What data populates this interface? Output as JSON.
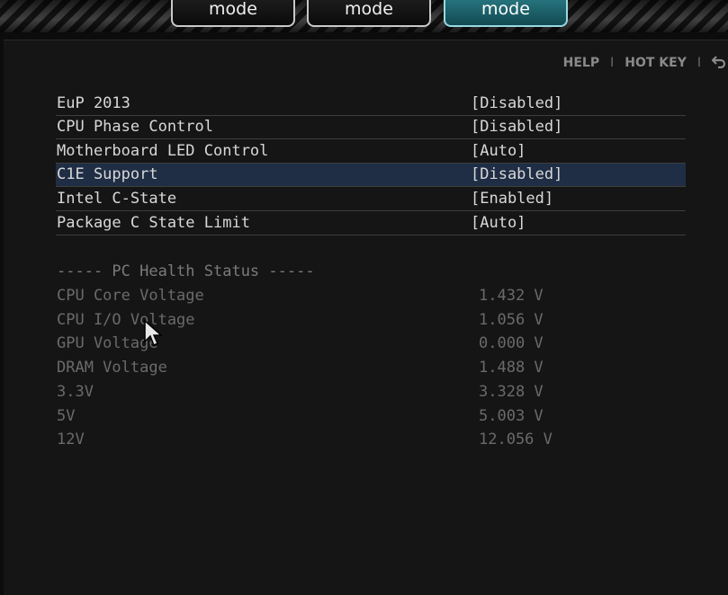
{
  "tabs": [
    {
      "label": "mode"
    },
    {
      "label": "mode"
    },
    {
      "label": "mode",
      "active": true
    }
  ],
  "hotbar": {
    "help": "HELP",
    "hotkey": "HOT KEY",
    "separator": "I",
    "back_icon": "back-arrow-icon"
  },
  "settings": [
    {
      "name": "EuP 2013",
      "value": "[Disabled]"
    },
    {
      "name": "CPU Phase Control",
      "value": "[Disabled]"
    },
    {
      "name": "Motherboard LED Control",
      "value": "[Auto]"
    },
    {
      "name": "C1E Support",
      "value": "[Disabled]",
      "selected": true
    },
    {
      "name": "Intel C-State",
      "value": "[Enabled]"
    },
    {
      "name": "Package C State Limit",
      "value": "[Auto]"
    }
  ],
  "health": {
    "header": "----- PC Health Status -----",
    "items": [
      {
        "name": "CPU Core Voltage",
        "value": "1.432 V"
      },
      {
        "name": "CPU I/O Voltage",
        "value": "1.056 V"
      },
      {
        "name": "GPU Voltage",
        "value": "0.000 V"
      },
      {
        "name": "DRAM Voltage",
        "value": "1.488 V"
      },
      {
        "name": "3.3V",
        "value": "3.328 V"
      },
      {
        "name": "5V",
        "value": "5.003 V"
      },
      {
        "name": "12V",
        "value": "12.056 V"
      }
    ]
  },
  "colors": {
    "accent": "#2a7c86",
    "selected_row": "#1f2d45",
    "background": "#151515"
  }
}
